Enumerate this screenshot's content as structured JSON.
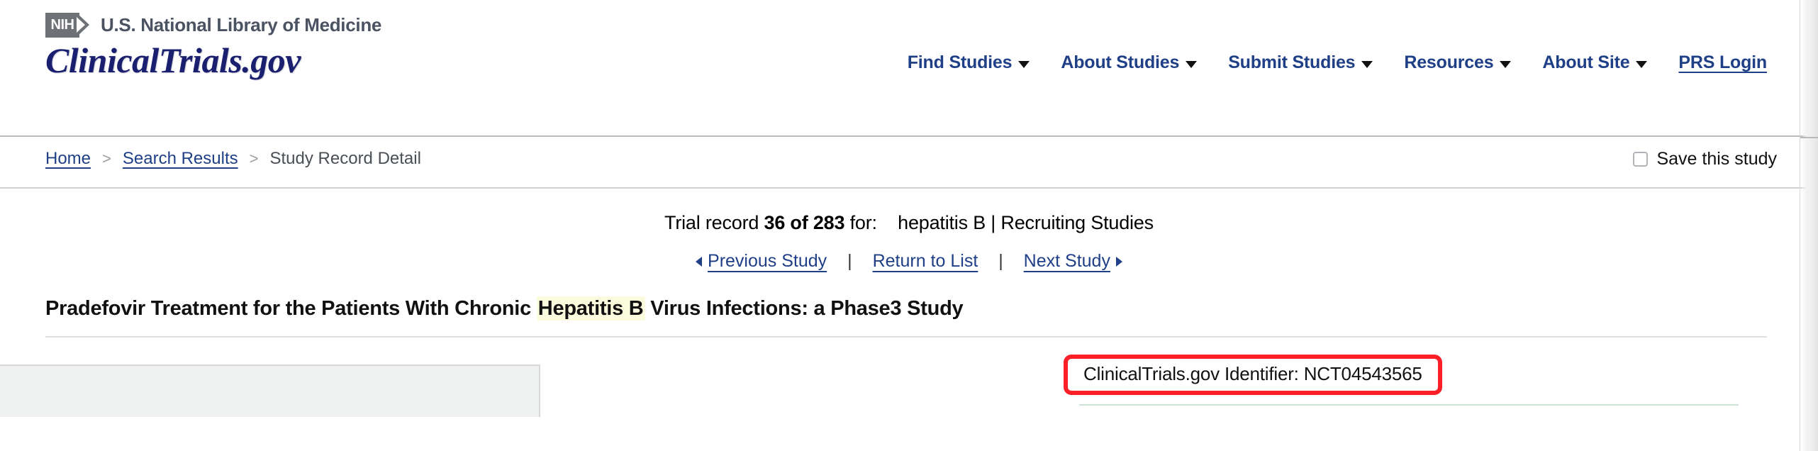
{
  "header": {
    "nih_logo_text": "NIH",
    "nih_logo_icon": "nih-chevron-logo",
    "organization": "U.S. National Library of Medicine",
    "site_logo": "ClinicalTrials.gov",
    "nav": [
      {
        "label": "Find Studies",
        "has_caret": true,
        "underlined": false
      },
      {
        "label": "About Studies",
        "has_caret": true,
        "underlined": false
      },
      {
        "label": "Submit Studies",
        "has_caret": true,
        "underlined": false
      },
      {
        "label": "Resources",
        "has_caret": true,
        "underlined": false
      },
      {
        "label": "About Site",
        "has_caret": true,
        "underlined": false
      },
      {
        "label": "PRS Login",
        "has_caret": false,
        "underlined": true
      }
    ]
  },
  "breadcrumb": {
    "home": "Home",
    "sep1": ">",
    "search_results": "Search Results",
    "sep2": ">",
    "current": "Study Record Detail"
  },
  "save_study": {
    "label": "Save this study",
    "checked": false,
    "checkbox_icon": "checkbox-unchecked"
  },
  "record": {
    "prefix": "Trial record",
    "count": "36 of 283",
    "for_label": "for:",
    "query": "hepatitis B | Recruiting Studies"
  },
  "study_nav": {
    "previous": "Previous Study",
    "return": "Return to List",
    "next": "Next Study",
    "separator": "|",
    "prev_icon": "triangle-left-icon",
    "next_icon": "triangle-right-icon"
  },
  "study": {
    "title_part1": "Pradefovir Treatment for the Patients With Chronic ",
    "title_highlight": "Hepatitis B",
    "title_part2": " Virus Infections: a Phase3 Study"
  },
  "identifier": {
    "text": "ClinicalTrials.gov Identifier: NCT04543565",
    "highlight_color": "#fb1f28"
  },
  "colors": {
    "link_navy": "#1f3f87",
    "logo_navy": "#1a1f70",
    "nih_gray": "#6e7175",
    "highlight_yellow": "#fbfbdd",
    "annotation_red": "#fb1f28"
  }
}
